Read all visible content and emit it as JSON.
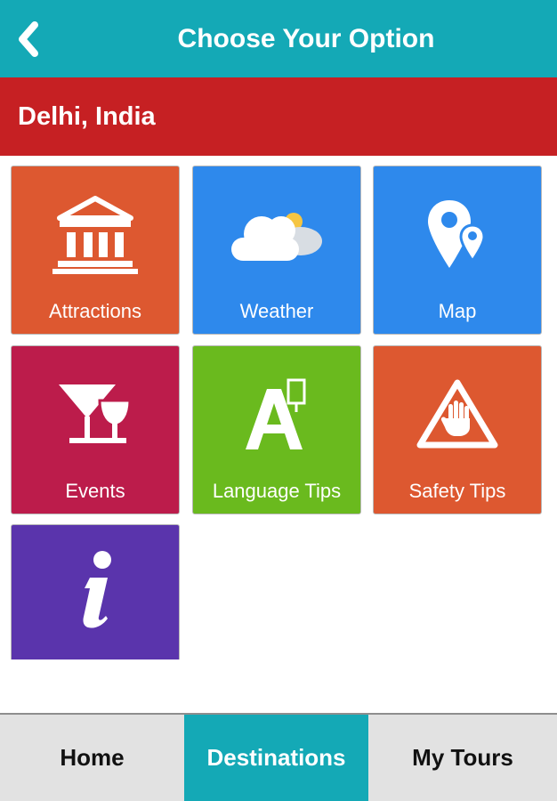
{
  "colors": {
    "header": "#14a9b6",
    "city_bar": "#c62023",
    "tab_active": "#14a9b6",
    "tab_inactive": "#e2e2e2"
  },
  "header": {
    "back_icon": "chevron-left-icon",
    "title": "Choose Your Option"
  },
  "city": {
    "name": "Delhi, India"
  },
  "tiles": [
    {
      "label": "Attractions",
      "icon": "museum-icon",
      "color": "#dd5830"
    },
    {
      "label": "Weather",
      "icon": "cloud-sun-icon",
      "color": "#2e89ec"
    },
    {
      "label": "Map",
      "icon": "map-pin-icon",
      "color": "#2e89ec"
    },
    {
      "label": "Events",
      "icon": "cocktail-glass-icon",
      "color": "#bc1c4b"
    },
    {
      "label": "Language Tips",
      "icon": "language-icon",
      "color": "#6aba1e"
    },
    {
      "label": "Safety Tips",
      "icon": "hand-warning-icon",
      "color": "#dd5830"
    },
    {
      "label": "",
      "icon": "info-icon",
      "color": "#5a34ac"
    }
  ],
  "tabbar": {
    "active": "Destinations",
    "tabs": [
      {
        "label": "Home"
      },
      {
        "label": "Destinations"
      },
      {
        "label": "My Tours"
      }
    ]
  }
}
